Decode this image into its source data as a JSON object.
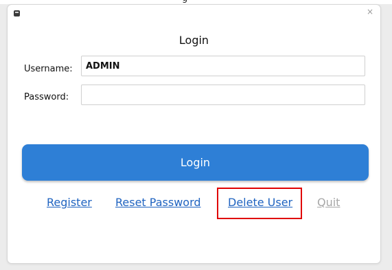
{
  "header": {
    "partial_title": "g"
  },
  "window": {
    "heading": "Login",
    "close_glyph": "×",
    "icons": {
      "app": "app-icon",
      "close": "close-icon"
    }
  },
  "form": {
    "username_label": "Username:",
    "username_value": "ADMIN",
    "password_label": "Password:",
    "password_value": ""
  },
  "actions": {
    "login_label": "Login",
    "register_label": "Register",
    "reset_password_label": "Reset Password",
    "delete_user_label": "Delete User",
    "quit_label": "Quit"
  },
  "colors": {
    "primary": "#2e7fd6",
    "link": "#1f63c0",
    "disabled_link": "#a7a7a7",
    "highlight": "#e00000"
  }
}
